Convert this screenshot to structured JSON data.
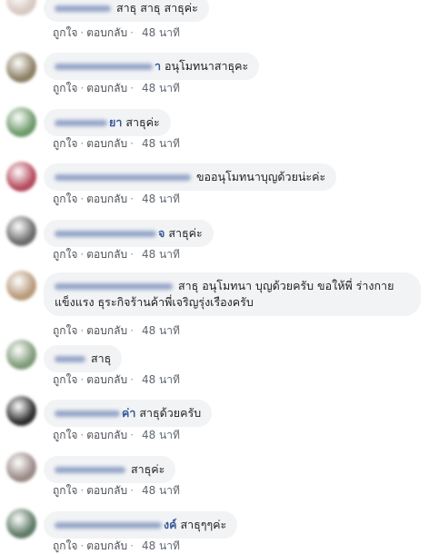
{
  "actions": {
    "like": "ถูกใจ",
    "separator": "·",
    "reply": "ตอบกลับ"
  },
  "comments": [
    {
      "name_tail": "",
      "text": "สาธุ สาธุ สาธุค่ะ",
      "time": "48 นาที",
      "avatar_color": "#d8c9c2"
    },
    {
      "name_tail": "า",
      "text": "อนุโมทนาสาธุคะ",
      "time": "48 นาที",
      "avatar_color": "#8c8064"
    },
    {
      "name_tail": "ยา",
      "text": "สาธุค่ะ",
      "time": "48 นาที",
      "avatar_color": "#6d9a6a"
    },
    {
      "name_tail": "",
      "text": "ขออนุโมทนาบุญด้วยน่ะค่ะ",
      "time": "48 นาที",
      "avatar_color": "#b54b5e"
    },
    {
      "name_tail": "จ",
      "text": "สาธุค่ะ",
      "time": "48 นาที",
      "avatar_color": "#6b6b6b"
    },
    {
      "name_tail": "",
      "text": "สาธุ อนุโมทนา บุญด้วยครับ ขอให้พี่ ร่างกายแข็งแรง ธุระกิจร้านค้าพี่เจริญรุ่งเรืองครับ",
      "time": "48 นาที",
      "avatar_color": "#b89a7a"
    },
    {
      "name_tail": "",
      "text": "สาธุ",
      "time": "48 นาที",
      "avatar_color": "#7f9a78"
    },
    {
      "name_tail": "ค่า",
      "text": "สาธุด้วยครับ",
      "time": "48 นาที",
      "avatar_color": "#2e2e2e"
    },
    {
      "name_tail": "",
      "text": "สาธุค่ะ",
      "time": "48 นาที",
      "avatar_color": "#9a8a86"
    },
    {
      "name_tail": "งค์",
      "text": "สาธุๆๆค่ะ",
      "time": "48 นาที",
      "avatar_color": "#5e7a66"
    }
  ]
}
